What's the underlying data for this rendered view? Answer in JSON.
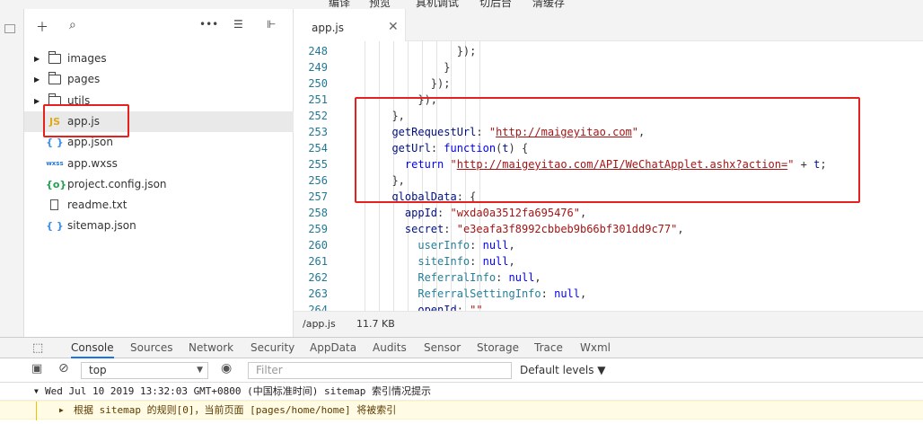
{
  "top_menu": [
    "编译",
    "预览",
    "真机调试",
    "切后台",
    "清缓存"
  ],
  "file_tree": {
    "items": [
      {
        "name": "images",
        "type": "folder"
      },
      {
        "name": "pages",
        "type": "folder"
      },
      {
        "name": "utils",
        "type": "folder"
      },
      {
        "name": "app.js",
        "type": "js",
        "icon": "JS",
        "selected": true
      },
      {
        "name": "app.json",
        "type": "json",
        "icon": "{ }"
      },
      {
        "name": "app.wxss",
        "type": "wxss",
        "icon": "wxss"
      },
      {
        "name": "project.config.json",
        "type": "config",
        "icon": "{o}"
      },
      {
        "name": "readme.txt",
        "type": "txt"
      },
      {
        "name": "sitemap.json",
        "type": "json",
        "icon": "{ }"
      }
    ]
  },
  "editor": {
    "tab_label": "app.js",
    "close_glyph": "✕",
    "lines": [
      {
        "n": "248",
        "code": "            });"
      },
      {
        "n": "249",
        "code": "          }"
      },
      {
        "n": "250",
        "code": "        });"
      },
      {
        "n": "251",
        "code": "      }),"
      },
      {
        "n": "252",
        "code": "  },"
      },
      {
        "n": "253",
        "code": "  getRequestUrl: \"http://maigeyitao.com\","
      },
      {
        "n": "254",
        "code": "  getUrl: function(t) {"
      },
      {
        "n": "255",
        "code": "    return \"http://maigeyitao.com/API/WeChatApplet.ashx?action=\" + t;"
      },
      {
        "n": "256",
        "code": "  },"
      },
      {
        "n": "257",
        "code": "  globalData: {"
      },
      {
        "n": "258",
        "code": "    appId: \"wxda0a3512fa695476\","
      },
      {
        "n": "259",
        "code": "    secret: \"e3eafa3f8992cbbeb9b66bf301dd9c77\","
      },
      {
        "n": "260",
        "code": "      userInfo: null,"
      },
      {
        "n": "261",
        "code": "      siteInfo: null,"
      },
      {
        "n": "262",
        "code": "      ReferralInfo: null,"
      },
      {
        "n": "263",
        "code": "      ReferralSettingInfo: null,"
      },
      {
        "n": "264",
        "code": "      openId: \"\""
      }
    ]
  },
  "status": {
    "path": "/app.js",
    "size": "11.7 KB"
  },
  "console": {
    "tabs": [
      "Console",
      "Sources",
      "Network",
      "Security",
      "AppData",
      "Audits",
      "Sensor",
      "Storage",
      "Trace",
      "Wxml"
    ],
    "active_tab": "Console",
    "context": "top",
    "filter_placeholder": "Filter",
    "levels": "Default levels ▼",
    "message_header": "Wed Jul 10 2019 13:32:03 GMT+0800 (中国标准时间) sitemap 索引情况提示",
    "message_body": "根据 sitemap 的规则[0]，当前页面 [pages/home/home] 将被索引"
  }
}
